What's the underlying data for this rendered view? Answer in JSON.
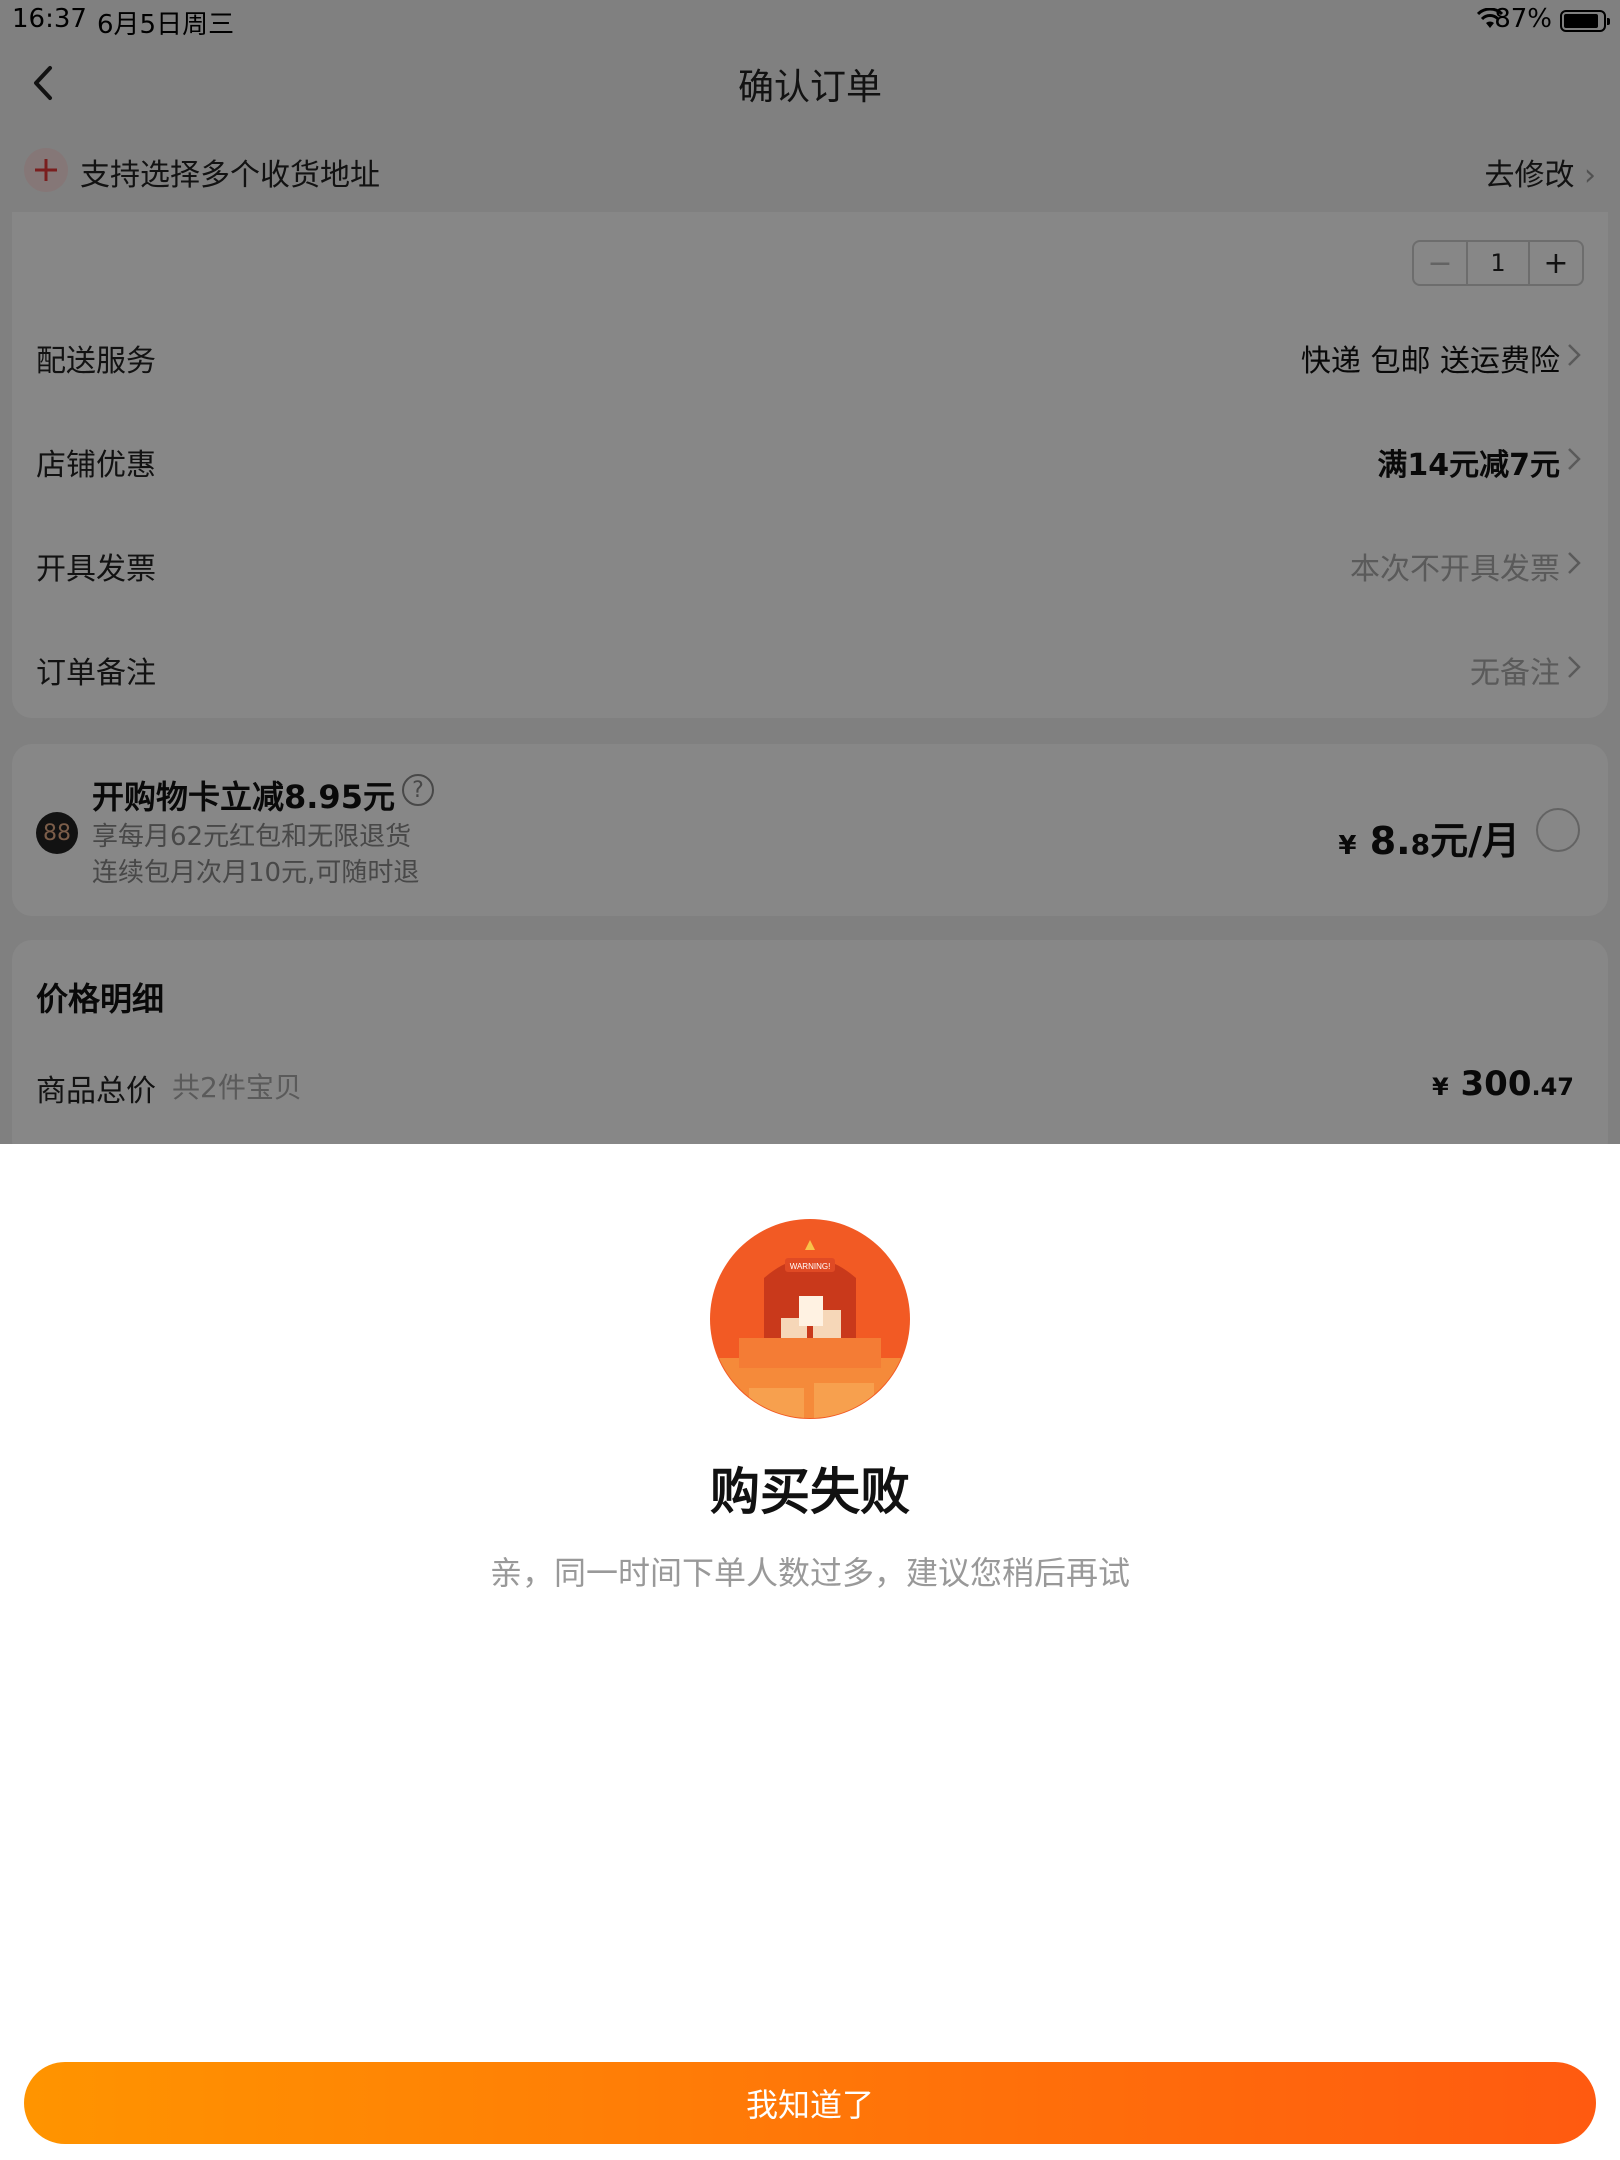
{
  "status_bar": {
    "time": "16:37",
    "date": "6月5日周三",
    "battery": "87%"
  },
  "header": {
    "title": "确认订单",
    "back_icon": "chevron-left-icon"
  },
  "address_bar": {
    "text": "支持选择多个收货地址",
    "modify_label": "去修改"
  },
  "stepper": {
    "minus": "−",
    "quantity": "1",
    "plus": "+"
  },
  "order_rows": [
    {
      "label": "配送服务",
      "value": "快递 包邮 送运费险"
    },
    {
      "label": "店铺优惠",
      "value": "满14元减7元"
    },
    {
      "label": "开具发票",
      "value": "本次不开具发票"
    },
    {
      "label": "订单备注",
      "value": "无备注"
    }
  ],
  "promo": {
    "icon_text": "88",
    "title": "开购物卡立减8.95元",
    "subtitle1": "享每月62元红包和无限退货",
    "subtitle2": "连续包月次月10元,可随时退",
    "price_yen": "¥",
    "price_int": "8.",
    "price_dec": "8",
    "price_unit": "元/月"
  },
  "price_detail": {
    "title": "价格明细",
    "subtotal_label": "商品总价",
    "subtotal_count": "共2件宝贝",
    "subtotal_yen": "¥",
    "subtotal_int": "300",
    "subtotal_dec": ".47"
  },
  "dialog": {
    "title": "购买失败",
    "message": "亲，同一时间下单人数过多，建议您稍后再试",
    "confirm_label": "我知道了",
    "illustration_label": "WARNING!"
  },
  "colors": {
    "accent_start": "#ff9400",
    "accent_end": "#ff5a10",
    "illustration_bg": "#f25a24"
  }
}
